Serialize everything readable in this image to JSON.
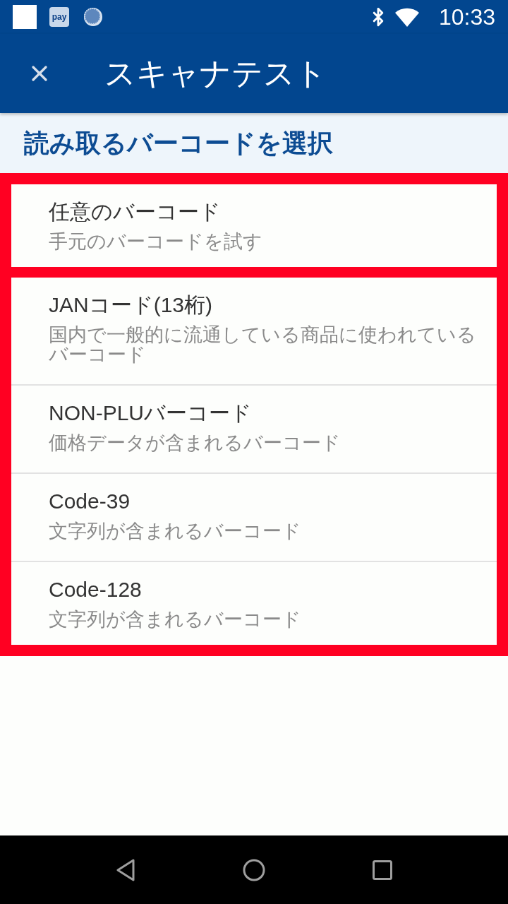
{
  "status_bar": {
    "badge": "pay",
    "time": "10:33"
  },
  "app_bar": {
    "title": "スキャナテスト"
  },
  "section_header": "読み取るバーコードを選択",
  "list": {
    "highlighted": true,
    "groups": [
      {
        "items": [
          {
            "title": "任意のバーコード",
            "subtitle": "手元のバーコードを試す"
          }
        ]
      },
      {
        "items": [
          {
            "title": "JANコード(13桁)",
            "subtitle": "国内で一般的に流通している商品に使われているバーコード"
          },
          {
            "title": "NON-PLUバーコード",
            "subtitle": "価格データが含まれるバーコード"
          },
          {
            "title": "Code-39",
            "subtitle": "文字列が含まれるバーコード"
          },
          {
            "title": "Code-128",
            "subtitle": "文字列が含まれるバーコード"
          }
        ]
      }
    ]
  }
}
